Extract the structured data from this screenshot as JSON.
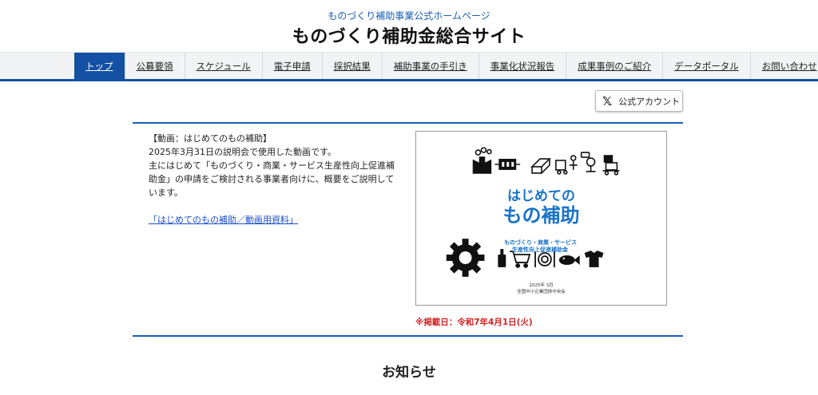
{
  "header": {
    "subtitle": "ものづくり補助事業公式ホームページ",
    "title": "ものづくり補助金総合サイト"
  },
  "nav": {
    "items": [
      {
        "label": "トップ",
        "active": true
      },
      {
        "label": "公募要領"
      },
      {
        "label": "スケジュール"
      },
      {
        "label": "電子申請"
      },
      {
        "label": "採択結果"
      },
      {
        "label": "補助事業の手引き"
      },
      {
        "label": "事業化状況報告"
      },
      {
        "label": "成果事例のご紹介"
      },
      {
        "label": "データポータル"
      },
      {
        "label": "お問い合わせ"
      }
    ]
  },
  "social": {
    "x_icon": "x-logo-icon",
    "label": "公式アカウント"
  },
  "video_section": {
    "heading": "【動画：はじめてのもの補助】",
    "line1": "2025年3月31日の説明会で使用した動画です。",
    "line2": "主にはじめて「ものづくり・商業・サービス生産性向上促進補助金」の申請をご検討される事業者向けに、概要をご説明しています。",
    "link_text": "「はじめてのもの補助／動画用資料」",
    "thumbnail": {
      "title_line1": "はじめての",
      "title_line2": "もの補助",
      "sub_line1": "ものづくり・商業・サービス",
      "sub_line2": "生産性向上促進補助金",
      "date": "2025年 3月",
      "org": "全国中小企業団体中央会"
    },
    "posted_date": "※掲載日：令和7年4月1日(火)"
  },
  "news": {
    "title": "お知らせ"
  },
  "colors": {
    "brand_blue": "#1450a3",
    "accent_red": "#d32222",
    "link_blue": "#1a4dcc"
  }
}
